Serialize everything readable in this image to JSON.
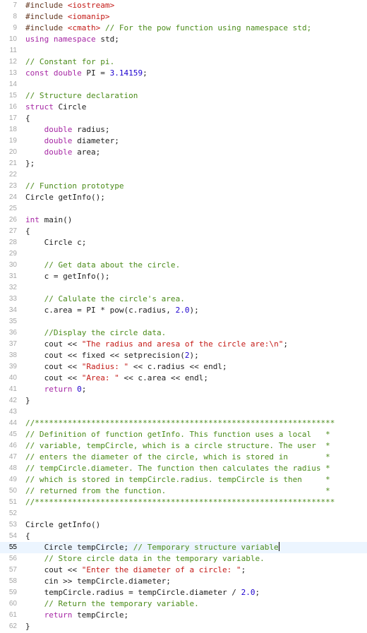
{
  "editor": {
    "language": "cpp",
    "current_line": 55,
    "colors": {
      "keyword": "#a626a4",
      "string": "#c41a16",
      "comment": "#4b8b1a",
      "number": "#1c00cf",
      "preprocessor": "#643820",
      "plain": "#1d1d1d",
      "line_number": "#a6a6a6",
      "current_line_bg": "#ecf5ff"
    },
    "lines": [
      {
        "n": "7",
        "tokens": [
          [
            "pp",
            "#include "
          ],
          [
            "str",
            "<iostream>"
          ]
        ]
      },
      {
        "n": "8",
        "tokens": [
          [
            "pp",
            "#include "
          ],
          [
            "str",
            "<iomanip>"
          ]
        ]
      },
      {
        "n": "9",
        "tokens": [
          [
            "pp",
            "#include "
          ],
          [
            "str",
            "<cmath>"
          ],
          [
            "plain",
            " "
          ],
          [
            "com",
            "// For the pow function using namespace std;"
          ]
        ]
      },
      {
        "n": "10",
        "tokens": [
          [
            "kw",
            "using"
          ],
          [
            "plain",
            " "
          ],
          [
            "kw",
            "namespace"
          ],
          [
            "plain",
            " std;"
          ]
        ]
      },
      {
        "n": "11",
        "tokens": []
      },
      {
        "n": "12",
        "tokens": [
          [
            "com",
            "// Constant for pi."
          ]
        ]
      },
      {
        "n": "13",
        "tokens": [
          [
            "kw",
            "const"
          ],
          [
            "plain",
            " "
          ],
          [
            "kw",
            "double"
          ],
          [
            "plain",
            " PI = "
          ],
          [
            "num",
            "3.14159"
          ],
          [
            "plain",
            ";"
          ]
        ]
      },
      {
        "n": "14",
        "tokens": []
      },
      {
        "n": "15",
        "tokens": [
          [
            "com",
            "// Structure declaration"
          ]
        ]
      },
      {
        "n": "16",
        "tokens": [
          [
            "kw",
            "struct"
          ],
          [
            "plain",
            " Circle"
          ]
        ]
      },
      {
        "n": "17",
        "tokens": [
          [
            "plain",
            "{"
          ]
        ]
      },
      {
        "n": "18",
        "tokens": [
          [
            "plain",
            "    "
          ],
          [
            "kw",
            "double"
          ],
          [
            "plain",
            " radius;"
          ]
        ]
      },
      {
        "n": "19",
        "tokens": [
          [
            "plain",
            "    "
          ],
          [
            "kw",
            "double"
          ],
          [
            "plain",
            " diameter;"
          ]
        ]
      },
      {
        "n": "20",
        "tokens": [
          [
            "plain",
            "    "
          ],
          [
            "kw",
            "double"
          ],
          [
            "plain",
            " area;"
          ]
        ]
      },
      {
        "n": "21",
        "tokens": [
          [
            "plain",
            "};"
          ]
        ]
      },
      {
        "n": "22",
        "tokens": []
      },
      {
        "n": "23",
        "tokens": [
          [
            "com",
            "// Function prototype"
          ]
        ]
      },
      {
        "n": "24",
        "tokens": [
          [
            "plain",
            "Circle getInfo();"
          ]
        ]
      },
      {
        "n": "25",
        "tokens": []
      },
      {
        "n": "26",
        "tokens": [
          [
            "kw",
            "int"
          ],
          [
            "plain",
            " main()"
          ]
        ]
      },
      {
        "n": "27",
        "tokens": [
          [
            "plain",
            "{"
          ]
        ]
      },
      {
        "n": "28",
        "tokens": [
          [
            "plain",
            "    Circle c;"
          ]
        ]
      },
      {
        "n": "29",
        "tokens": []
      },
      {
        "n": "30",
        "tokens": [
          [
            "plain",
            "    "
          ],
          [
            "com",
            "// Get data about the circle."
          ]
        ]
      },
      {
        "n": "31",
        "tokens": [
          [
            "plain",
            "    c = getInfo();"
          ]
        ]
      },
      {
        "n": "32",
        "tokens": []
      },
      {
        "n": "33",
        "tokens": [
          [
            "plain",
            "    "
          ],
          [
            "com",
            "// Calulate the circle's area."
          ]
        ]
      },
      {
        "n": "34",
        "tokens": [
          [
            "plain",
            "    c.area = PI * pow(c.radius, "
          ],
          [
            "num",
            "2.0"
          ],
          [
            "plain",
            ");"
          ]
        ]
      },
      {
        "n": "35",
        "tokens": []
      },
      {
        "n": "36",
        "tokens": [
          [
            "plain",
            "    "
          ],
          [
            "com",
            "//Display the circle data."
          ]
        ]
      },
      {
        "n": "37",
        "tokens": [
          [
            "plain",
            "    cout << "
          ],
          [
            "str",
            "\"The radius and aresa of the circle are:\\n\""
          ],
          [
            "plain",
            ";"
          ]
        ]
      },
      {
        "n": "38",
        "tokens": [
          [
            "plain",
            "    cout << fixed << setprecision("
          ],
          [
            "num",
            "2"
          ],
          [
            "plain",
            ");"
          ]
        ]
      },
      {
        "n": "39",
        "tokens": [
          [
            "plain",
            "    cout << "
          ],
          [
            "str",
            "\"Radius: \""
          ],
          [
            "plain",
            " << c.radius << endl;"
          ]
        ]
      },
      {
        "n": "40",
        "tokens": [
          [
            "plain",
            "    cout << "
          ],
          [
            "str",
            "\"Area: \""
          ],
          [
            "plain",
            " << c.area << endl;"
          ]
        ]
      },
      {
        "n": "41",
        "tokens": [
          [
            "plain",
            "    "
          ],
          [
            "kw",
            "return"
          ],
          [
            "plain",
            " "
          ],
          [
            "num",
            "0"
          ],
          [
            "plain",
            ";"
          ]
        ]
      },
      {
        "n": "42",
        "tokens": [
          [
            "plain",
            "}"
          ]
        ]
      },
      {
        "n": "43",
        "tokens": []
      },
      {
        "n": "44",
        "tokens": [
          [
            "com",
            "//****************************************************************"
          ]
        ]
      },
      {
        "n": "45",
        "tokens": [
          [
            "com",
            "// Definition of function getInfo. This function uses a local   *"
          ]
        ]
      },
      {
        "n": "46",
        "tokens": [
          [
            "com",
            "// variable, tempCircle, which is a circle structure. The user  *"
          ]
        ]
      },
      {
        "n": "47",
        "tokens": [
          [
            "com",
            "// enters the diameter of the circle, which is stored in        *"
          ]
        ]
      },
      {
        "n": "48",
        "tokens": [
          [
            "com",
            "// tempCircle.diameter. The function then calculates the radius *"
          ]
        ]
      },
      {
        "n": "49",
        "tokens": [
          [
            "com",
            "// which is stored in tempCircle.radius. tempCircle is then     *"
          ]
        ]
      },
      {
        "n": "50",
        "tokens": [
          [
            "com",
            "// returned from the function.                                  *"
          ]
        ]
      },
      {
        "n": "51",
        "tokens": [
          [
            "com",
            "//****************************************************************"
          ]
        ]
      },
      {
        "n": "52",
        "tokens": []
      },
      {
        "n": "53",
        "tokens": [
          [
            "plain",
            "Circle getInfo()"
          ]
        ]
      },
      {
        "n": "54",
        "tokens": [
          [
            "plain",
            "{"
          ]
        ]
      },
      {
        "n": "55",
        "tokens": [
          [
            "plain",
            "    Circle tempCircle; "
          ],
          [
            "com",
            "// Temporary structure variable"
          ]
        ],
        "caret": true
      },
      {
        "n": "56",
        "tokens": [
          [
            "plain",
            "    "
          ],
          [
            "com",
            "// Store circle data in the temporary variable."
          ]
        ]
      },
      {
        "n": "57",
        "tokens": [
          [
            "plain",
            "    cout << "
          ],
          [
            "str",
            "\"Enter the diameter of a circle: \""
          ],
          [
            "plain",
            ";"
          ]
        ]
      },
      {
        "n": "58",
        "tokens": [
          [
            "plain",
            "    cin >> tempCircle.diameter;"
          ]
        ]
      },
      {
        "n": "59",
        "tokens": [
          [
            "plain",
            "    tempCircle.radius = tempCircle.diameter / "
          ],
          [
            "num",
            "2.0"
          ],
          [
            "plain",
            ";"
          ]
        ]
      },
      {
        "n": "60",
        "tokens": [
          [
            "plain",
            "    "
          ],
          [
            "com",
            "// Return the temporary variable."
          ]
        ]
      },
      {
        "n": "61",
        "tokens": [
          [
            "plain",
            "    "
          ],
          [
            "kw",
            "return"
          ],
          [
            "plain",
            " tempCircle;"
          ]
        ]
      },
      {
        "n": "62",
        "tokens": [
          [
            "plain",
            "}"
          ]
        ]
      }
    ]
  }
}
